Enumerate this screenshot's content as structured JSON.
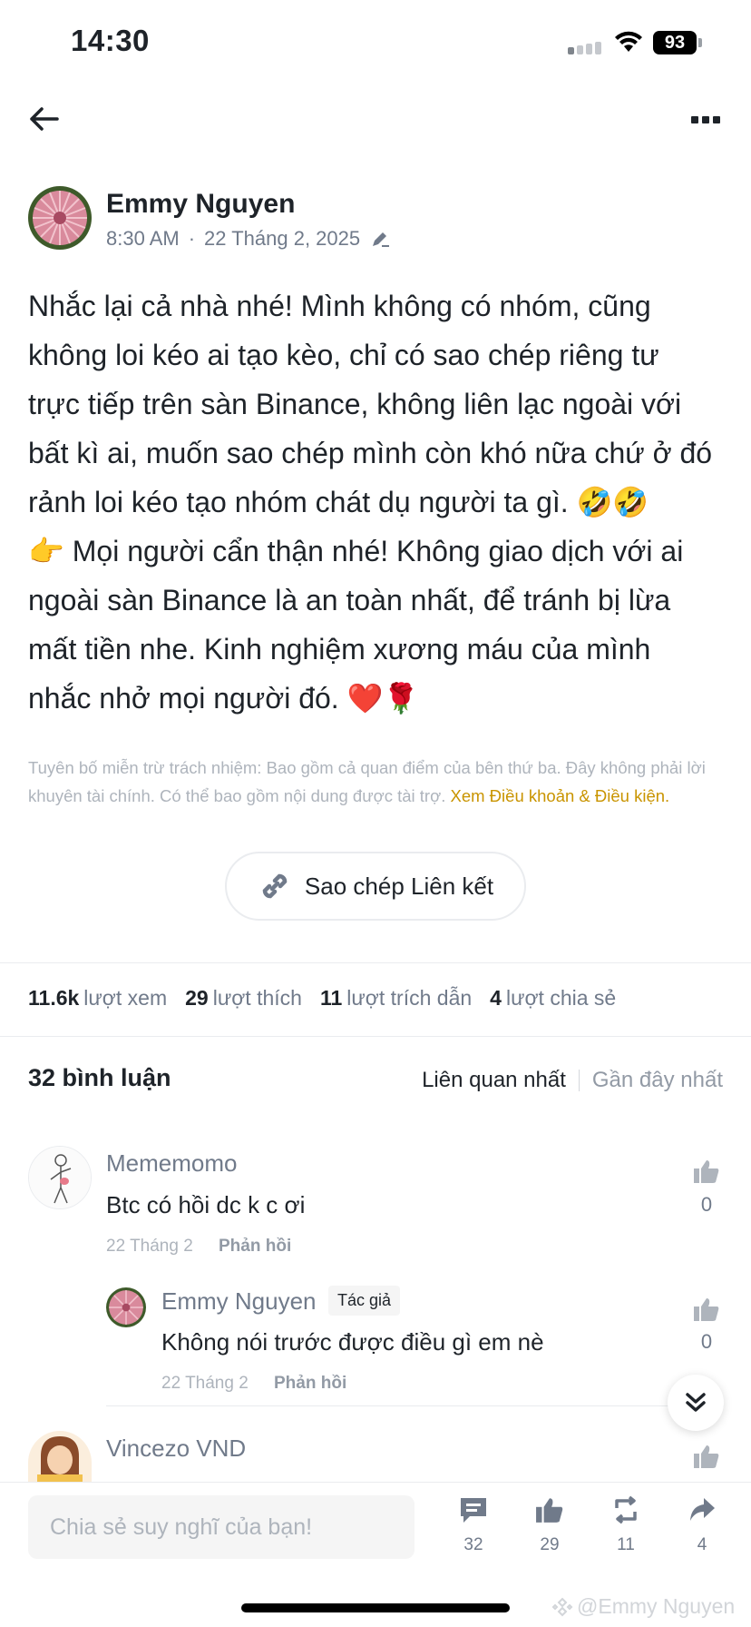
{
  "status_bar": {
    "time": "14:30",
    "battery": "93"
  },
  "post": {
    "author_name": "Emmy Nguyen",
    "time": "8:30 AM",
    "date": "22 Tháng 2, 2025",
    "body_lines": [
      "Nhắc lại cả nhà nhé! Mình không có nhóm, cũng",
      "không loi kéo ai tạo kèo, chỉ có sao chép riêng tư",
      "trực tiếp trên sàn Binance, không liên lạc ngoài với",
      "bất kì ai, muốn sao chép mình còn khó nữa chứ ở đó",
      "rảnh loi kéo tạo nhóm chát dụ người ta gì. 🤣🤣",
      "👉 Mọi người cẩn thận nhé! Không giao dịch với ai",
      "ngoài sàn Binance là an toàn nhất, để tránh bị lừa",
      "mất tiền nhe. Kinh nghiệm xương máu của mình",
      "nhắc nhở mọi người đó. ❤️🌹"
    ],
    "disclaimer_text": "Tuyên bố miễn trừ trách nhiệm: Bao gồm cả quan điểm của bên thứ ba. Đây không phải lời khuyên tài chính. Có thể bao gồm nội dung được tài trợ.",
    "disclaimer_link": "Xem Điều khoản & Điều kiện.",
    "copy_link_label": "Sao chép Liên kết"
  },
  "stats": {
    "views": "11.6k",
    "views_label": "lượt xem",
    "likes": "29",
    "likes_label": "lượt thích",
    "quotes": "11",
    "quotes_label": "lượt trích dẫn",
    "shares": "4",
    "shares_label": "lượt chia sẻ"
  },
  "comments_section": {
    "title": "32 bình luận",
    "sort_relevant": "Liên quan nhất",
    "sort_recent": "Gần đây nhất"
  },
  "comments": [
    {
      "name": "Mememomo",
      "text": "Btc có hồi dc k c ơi",
      "date": "22 Tháng 2",
      "reply": "Phản hồi",
      "likes": "0"
    },
    {
      "name": "Emmy Nguyen",
      "badge": "Tác giả",
      "text": "Không nói trước được điều gì em nè",
      "date": "22 Tháng 2",
      "reply": "Phản hồi",
      "likes": "0"
    },
    {
      "name": "Vincezo VND"
    }
  ],
  "bottom_bar": {
    "input_placeholder": "Chia sẻ suy nghĩ của bạn!",
    "comments_count": "32",
    "likes_count": "29",
    "reposts_count": "11",
    "shares_count": "4"
  },
  "watermark": "@Emmy Nguyen"
}
